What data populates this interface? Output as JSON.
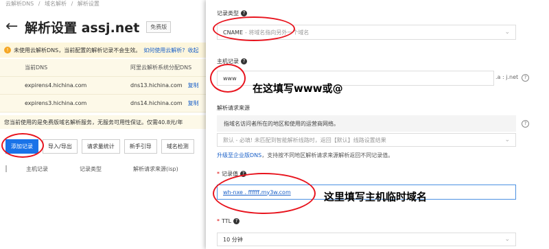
{
  "breadcrumb": [
    "云解析DNS",
    "/",
    "域名解析",
    "/",
    "解析设置"
  ],
  "page": {
    "back_icon": "arrow-left-icon",
    "title": "解析设置 assj.net",
    "badge": "免费版"
  },
  "warning": {
    "text": "未使用云解析DNS，当前配置的解析记录不会生效。",
    "link1": "如何使用云解析?",
    "link2": "收起"
  },
  "ns_table": {
    "headers": [
      "当前DNS",
      "阿里云解析系统分配DNS"
    ],
    "rows": [
      {
        "current": "expirens4.hichina.com",
        "assigned": "dns13.hichina.com",
        "copy": "复制"
      },
      {
        "current": "expirens3.hichina.com",
        "assigned": "dns14.hichina.com",
        "copy": "复制"
      }
    ]
  },
  "notice": "您当前使用的是免费版域名解析服务，无服务可用性保证。仅需40.8元/年",
  "toolbar": [
    "添加记录",
    "导入/导出",
    "请求量统计",
    "新手引导",
    "域名检测"
  ],
  "columns": [
    "主机记录",
    "记录类型",
    "解析请求来源(isp)"
  ],
  "form": {
    "record_type_label": "记录类型",
    "record_type_value": "CNAME",
    "record_type_hint": "- 将域名指向另外一个域名",
    "host_label": "主机记录",
    "host_value": "www",
    "host_suffix": ".a : j.net",
    "line_label": "解析请求来源",
    "line_tip": "指域名访问者所在的地区和使用的运营商网络。",
    "line_value": "默认 - 必填! 未匹配到智能解析线路时，返回【默认】线路设置结果",
    "upgrade_link": "升级至企业版DNS",
    "upgrade_text": "，支持按不同地区解析请求来源解析返回不同记录值。",
    "value_label": "记录值",
    "value_value": "wh-nxe . ffffff.my3w.com",
    "ttl_label": "TTL",
    "ttl_value": "10 分钟",
    "help_mark": "?"
  },
  "annotations": {
    "host": "在这填写www或@",
    "value": "这里填写主机临时域名"
  },
  "colors": {
    "primary": "#1a73e8",
    "link": "#1a60c8",
    "highlight": "#e8141e",
    "warning_bg": "#fdf6dc"
  }
}
